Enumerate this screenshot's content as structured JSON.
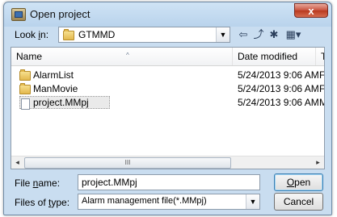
{
  "window": {
    "title": "Open project",
    "close_glyph": "x",
    "app_icon": "open-project-icon"
  },
  "lookin": {
    "label_pre": "Look ",
    "label_u": "i",
    "label_post": "n:",
    "folder": "GTMMD",
    "folder_icon": "folder-icon",
    "dropdown_glyph": "▼"
  },
  "toolbar": {
    "back_glyph": "⇦",
    "up_glyph": "⤴",
    "newfolder_glyph": "✱",
    "views_glyph": "▦▾"
  },
  "list": {
    "columns": [
      "Name",
      "Date modified",
      "Ty"
    ],
    "sort_glyph": "^",
    "rows": [
      {
        "name": "AlarmList",
        "date": "5/24/2013 9:06 AM",
        "type": "Fi",
        "icon": "folder-icon"
      },
      {
        "name": "ManMovie",
        "date": "5/24/2013 9:06 AM",
        "type": "Fi",
        "icon": "folder-icon"
      },
      {
        "name": "project.MMpj",
        "date": "5/24/2013 9:06 AM",
        "type": "M",
        "icon": "file-icon"
      }
    ],
    "scroll_left": "◂",
    "scroll_right": "▸",
    "scroll_grip": "III"
  },
  "filename": {
    "label_pre": "File ",
    "label_u": "n",
    "label_post": "ame:",
    "value": "project.MMpj"
  },
  "filetype": {
    "label_pre": "Files of ",
    "label_u": "t",
    "label_post": "ype:",
    "value": "Alarm management file(*.MMpj)",
    "dropdown_glyph": "▼"
  },
  "buttons": {
    "open_u": "O",
    "open_rest": "pen",
    "cancel": "Cancel"
  }
}
